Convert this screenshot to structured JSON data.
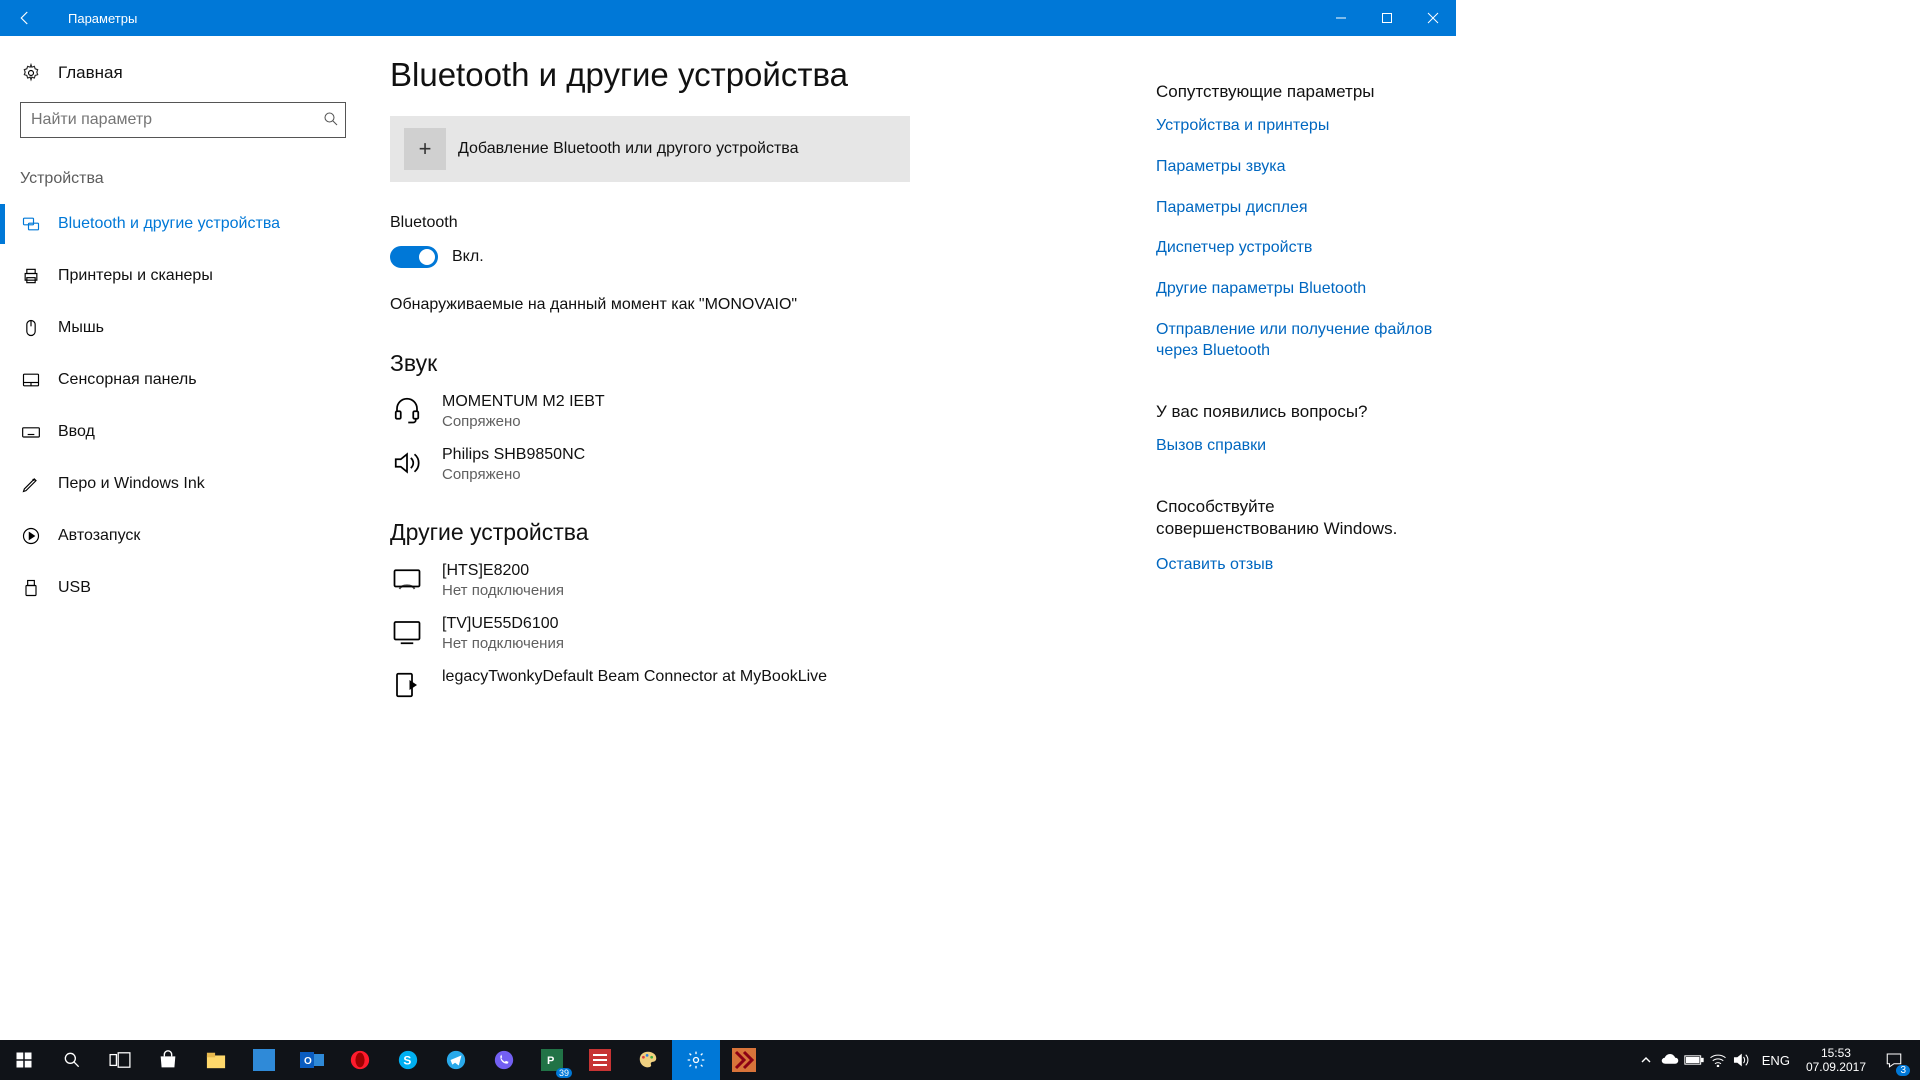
{
  "titlebar": {
    "title": "Параметры"
  },
  "sidebar": {
    "home": "Главная",
    "search_placeholder": "Найти параметр",
    "category": "Устройства",
    "items": [
      {
        "label": "Bluetooth и другие устройства"
      },
      {
        "label": "Принтеры и сканеры"
      },
      {
        "label": "Мышь"
      },
      {
        "label": "Сенсорная панель"
      },
      {
        "label": "Ввод"
      },
      {
        "label": "Перо и Windows Ink"
      },
      {
        "label": "Автозапуск"
      },
      {
        "label": "USB"
      }
    ]
  },
  "main": {
    "title": "Bluetooth и другие устройства",
    "add_device": "Добавление Bluetooth или другого устройства",
    "bluetooth_label": "Bluetooth",
    "toggle_state": "Вкл.",
    "discoverable": "Обнаруживаемые на данный момент как \"MONOVAIO\"",
    "audio_section": "Звук",
    "audio_devices": [
      {
        "name": "MOMENTUM M2 IEBT",
        "status": "Сопряжено"
      },
      {
        "name": "Philips SHB9850NC",
        "status": "Сопряжено"
      }
    ],
    "other_section": "Другие устройства",
    "other_devices": [
      {
        "name": "[HTS]E8200",
        "status": "Нет подключения"
      },
      {
        "name": "[TV]UE55D6100",
        "status": "Нет подключения"
      },
      {
        "name": "legacyTwonkyDefault Beam Connector at MyBookLive",
        "status": ""
      }
    ]
  },
  "right": {
    "related_head": "Сопутствующие параметры",
    "links": [
      "Устройства и принтеры",
      "Параметры звука",
      "Параметры дисплея",
      "Диспетчер устройств",
      "Другие параметры Bluetooth",
      "Отправление или получение файлов через Bluetooth"
    ],
    "help_head": "У вас появились вопросы?",
    "help_link": "Вызов справки",
    "feedback_head": "Способствуйте совершенствованию Windows.",
    "feedback_link": "Оставить отзыв"
  },
  "taskbar": {
    "lang": "ENG",
    "time": "15:53",
    "date": "07.09.2017",
    "notifications": "3",
    "badge_count": "39"
  }
}
